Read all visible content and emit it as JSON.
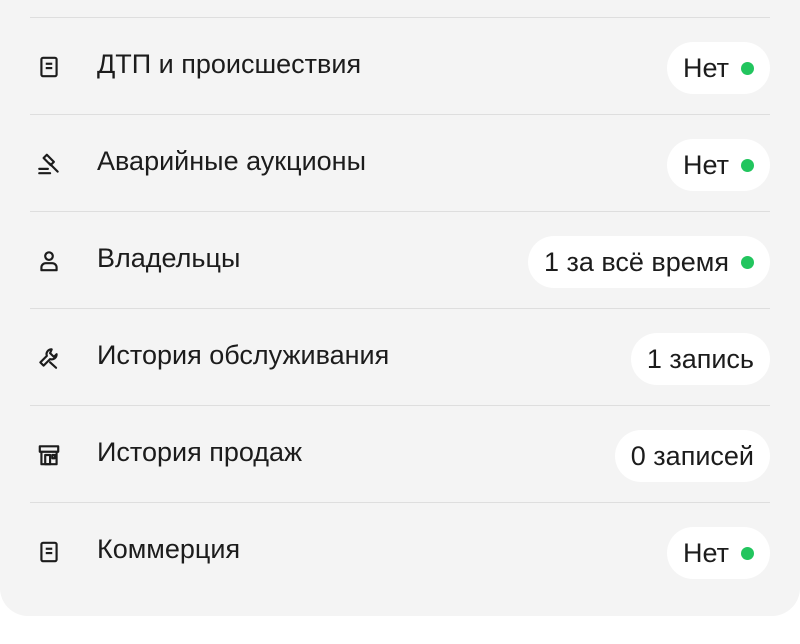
{
  "colors": {
    "ok_dot": "#22c55e",
    "card_bg": "#f4f4f4",
    "badge_bg": "#ffffff",
    "text": "#1c1c1c"
  },
  "report": {
    "items": [
      {
        "label": "ДТП и происшествия",
        "icon": "document-icon",
        "value": "Нет",
        "status_dot": true
      },
      {
        "label": "Аварийные аукционы",
        "icon": "gavel-icon",
        "value": "Нет",
        "status_dot": true
      },
      {
        "label": "Владельцы",
        "icon": "person-icon",
        "value": "1 за всё время",
        "status_dot": true
      },
      {
        "label": "История обслуживания",
        "icon": "wrench-icon",
        "value": "1 запись",
        "status_dot": false
      },
      {
        "label": "История продаж",
        "icon": "storefront-icon",
        "value": "0 записей",
        "status_dot": false
      },
      {
        "label": "Коммерция",
        "icon": "document-icon",
        "value": "Нет",
        "status_dot": true
      }
    ]
  }
}
